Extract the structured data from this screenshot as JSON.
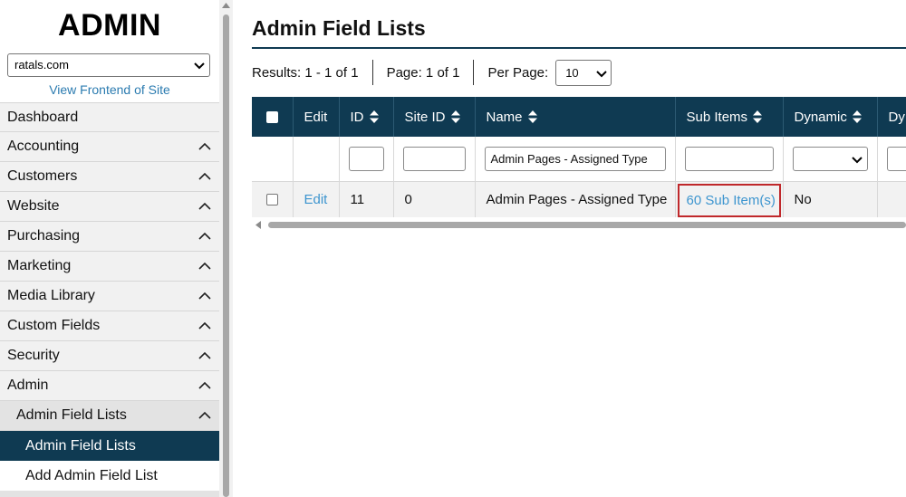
{
  "sidebar": {
    "brand": "ADMIN",
    "site_select": "ratals.com",
    "view_frontend": "View Frontend of Site",
    "items": [
      {
        "label": "Dashboard"
      },
      {
        "label": "Accounting"
      },
      {
        "label": "Customers"
      },
      {
        "label": "Website"
      },
      {
        "label": "Purchasing"
      },
      {
        "label": "Marketing"
      },
      {
        "label": "Media Library"
      },
      {
        "label": "Custom Fields"
      },
      {
        "label": "Security"
      },
      {
        "label": "Admin"
      }
    ],
    "sub_group": "Admin Field Lists",
    "sub_items": [
      "Admin Field Lists",
      "Add Admin Field List"
    ]
  },
  "main": {
    "title": "Admin Field Lists",
    "results": "Results: 1 - 1 of 1",
    "page": "Page: 1 of 1",
    "per_page_label": "Per Page:",
    "per_page_value": "10"
  },
  "table": {
    "headers": {
      "edit": "Edit",
      "id": "ID",
      "site_id": "Site ID",
      "name": "Name",
      "sub_items": "Sub Items",
      "dynamic": "Dynamic",
      "next": "Dy"
    },
    "filters": {
      "name": "Admin Pages - Assigned Type"
    },
    "rows": [
      {
        "edit": "Edit",
        "id": "11",
        "site_id": "0",
        "name": "Admin Pages - Assigned Type",
        "sub_items": "60 Sub Item(s)",
        "dynamic": "No"
      }
    ]
  },
  "colors": {
    "accent": "#0f3a52",
    "link": "#3d95cf",
    "highlight": "#c0282b"
  }
}
